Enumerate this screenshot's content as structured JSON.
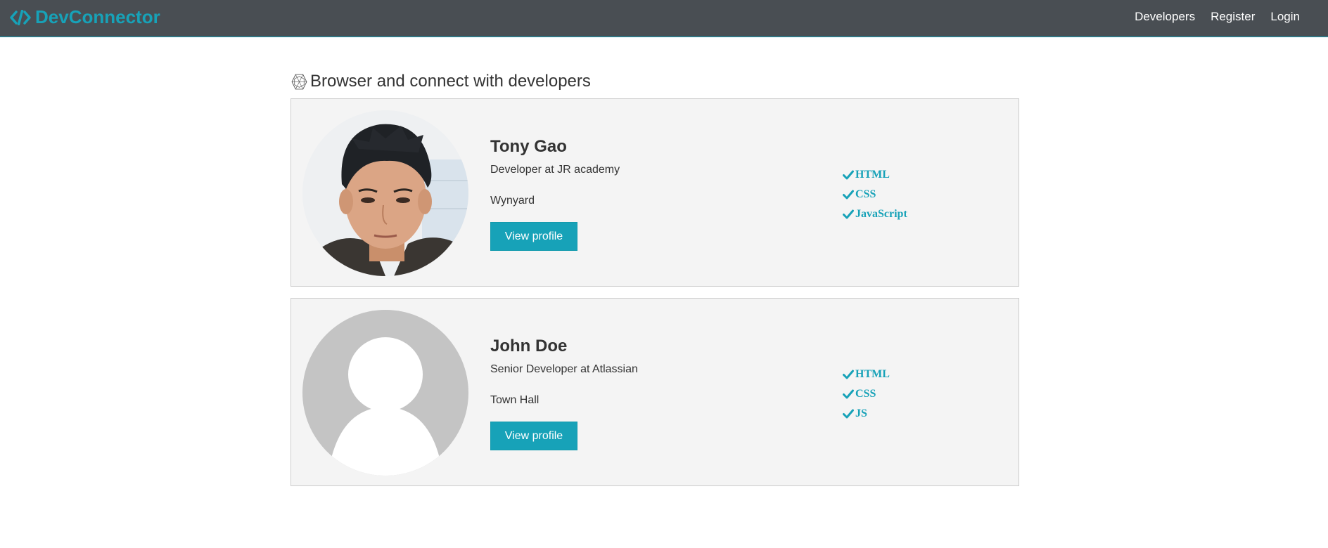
{
  "navbar": {
    "brand": "DevConnector",
    "links": [
      "Developers",
      "Register",
      "Login"
    ],
    "accent_color": "#17a2b8",
    "background_color": "#494e53"
  },
  "page": {
    "lead_icon": "connect-develop-icon",
    "lead_text": "Browser and connect with developers"
  },
  "profiles": [
    {
      "name": "Tony Gao",
      "status": "Developer at JR academy",
      "location": "Wynyard",
      "button": "View profile",
      "avatar": "profile-photo",
      "skills": [
        "HTML",
        "CSS",
        "JavaScript"
      ]
    },
    {
      "name": "John Doe",
      "status": "Senior Developer at Atlassian",
      "location": "Town Hall",
      "button": "View profile",
      "avatar": "default-avatar",
      "skills": [
        "HTML",
        "CSS",
        "JS"
      ]
    }
  ]
}
